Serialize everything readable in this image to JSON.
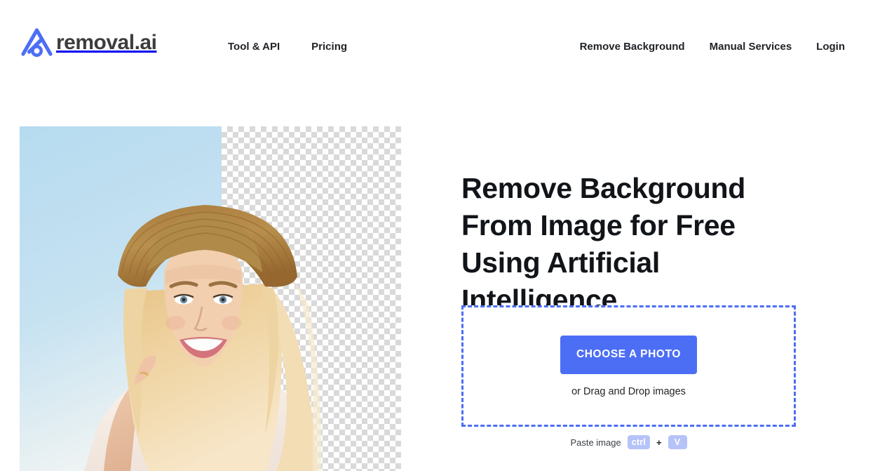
{
  "brand": {
    "name": "removal.ai",
    "logo_icon": "removal-ai-logo-icon",
    "logo_color": "#4c6ef5",
    "text_color": "#3d3d3d"
  },
  "nav": {
    "left_items": [
      {
        "label": "Tool & API"
      },
      {
        "label": "Pricing"
      }
    ],
    "right_items": [
      {
        "label": "Remove Background"
      },
      {
        "label": "Manual Services"
      },
      {
        "label": "Login"
      }
    ]
  },
  "hero": {
    "headline": "Remove Background From Image for Free Using Artificial Intelligence",
    "preview_image_alt": "Smiling blonde woman wearing a straw hat, background partially removed showing transparency checkerboard",
    "checkerboard": {
      "light": "#ffffff",
      "dark": "#d9d9d9",
      "square_size_px": 8
    },
    "photo_sky_color": "#b8dcf0"
  },
  "dropzone": {
    "button_label": "CHOOSE A PHOTO",
    "button_color": "#4c6ef5",
    "border_color": "#4c6ef5",
    "hint": "or Drag and Drop images"
  },
  "paste": {
    "label": "Paste image",
    "keys": [
      "ctrl",
      "V"
    ],
    "separator": "+",
    "key_bg": "#b6c3f8"
  }
}
